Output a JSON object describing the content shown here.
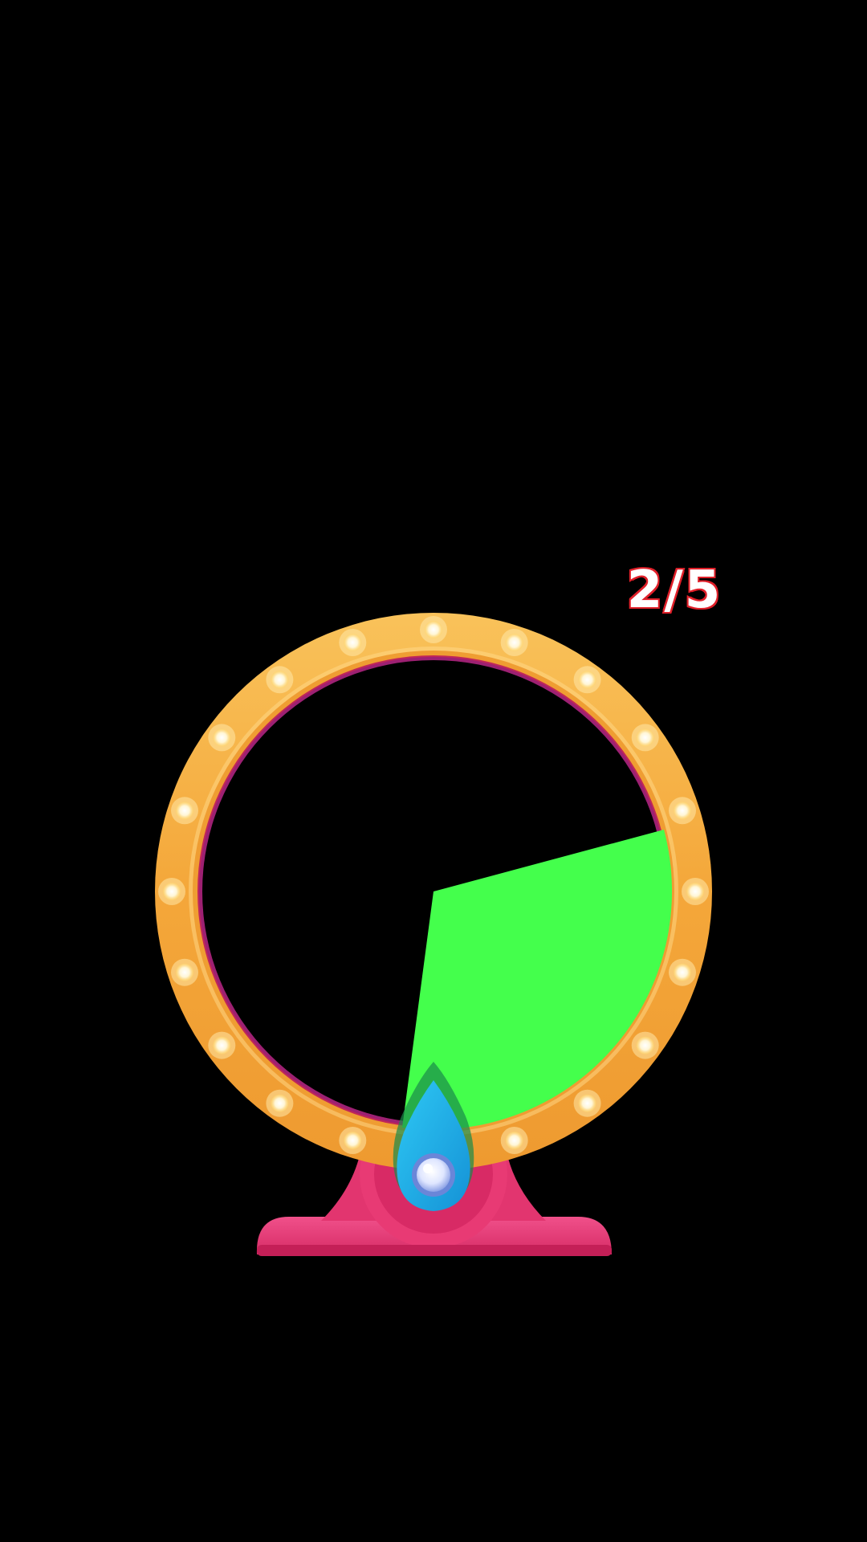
{
  "game": {
    "spin_counter": "2/5",
    "progress": {
      "current": 2,
      "total": 5
    }
  },
  "wheel": {
    "highlight_sector": {
      "color": "#44ff4c",
      "start_angle_deg": 15.5,
      "end_angle_deg": 172.5
    },
    "rim_color": "#f4a73a",
    "inner_ring_color": "#c0265a",
    "bulb_count": 20
  },
  "stand": {
    "color": "#e83a74"
  },
  "pointer": {
    "color": "#1fb2e8"
  },
  "icons": {
    "pointer": "droplet-pointer-icon",
    "bulb": "light-bulb-icon"
  }
}
